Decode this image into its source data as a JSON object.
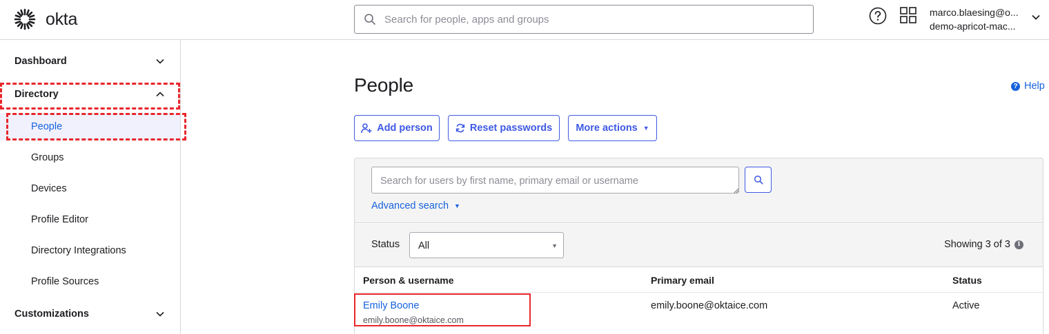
{
  "header": {
    "brand": "okta",
    "search_placeholder": "Search for people, apps and groups",
    "user_name": "marco.blaesing@o...",
    "user_org": "demo-apricot-mac..."
  },
  "sidebar": {
    "sections": [
      {
        "label": "Dashboard",
        "chevron": "chevron-down-icon"
      },
      {
        "label": "Directory",
        "chevron": "chevron-up-icon"
      },
      {
        "label": "Customizations",
        "chevron": "chevron-down-icon"
      }
    ],
    "directory_items": [
      {
        "label": "People",
        "active": true
      },
      {
        "label": "Groups",
        "active": false
      },
      {
        "label": "Devices",
        "active": false
      },
      {
        "label": "Profile Editor",
        "active": false
      },
      {
        "label": "Directory Integrations",
        "active": false
      },
      {
        "label": "Profile Sources",
        "active": false
      }
    ]
  },
  "main": {
    "title": "People",
    "help_label": "Help",
    "buttons": {
      "add_person": "Add person",
      "reset_passwords": "Reset passwords",
      "more_actions": "More actions"
    },
    "user_search_placeholder": "Search for users by first name, primary email or username",
    "advanced_search": "Advanced search",
    "status_label": "Status",
    "status_value": "All",
    "showing": "Showing 3 of 3",
    "table": {
      "columns": [
        "Person & username",
        "Primary email",
        "Status"
      ],
      "rows": [
        {
          "name": "Emily Boone",
          "username": "emily.boone@oktaice.com",
          "email": "emily.boone@oktaice.com",
          "status": "Active"
        }
      ]
    }
  },
  "colors": {
    "accent": "#3f59e4",
    "link": "#1662dd",
    "highlight": "#e8262b",
    "active_bg": "#f0f1fd"
  }
}
